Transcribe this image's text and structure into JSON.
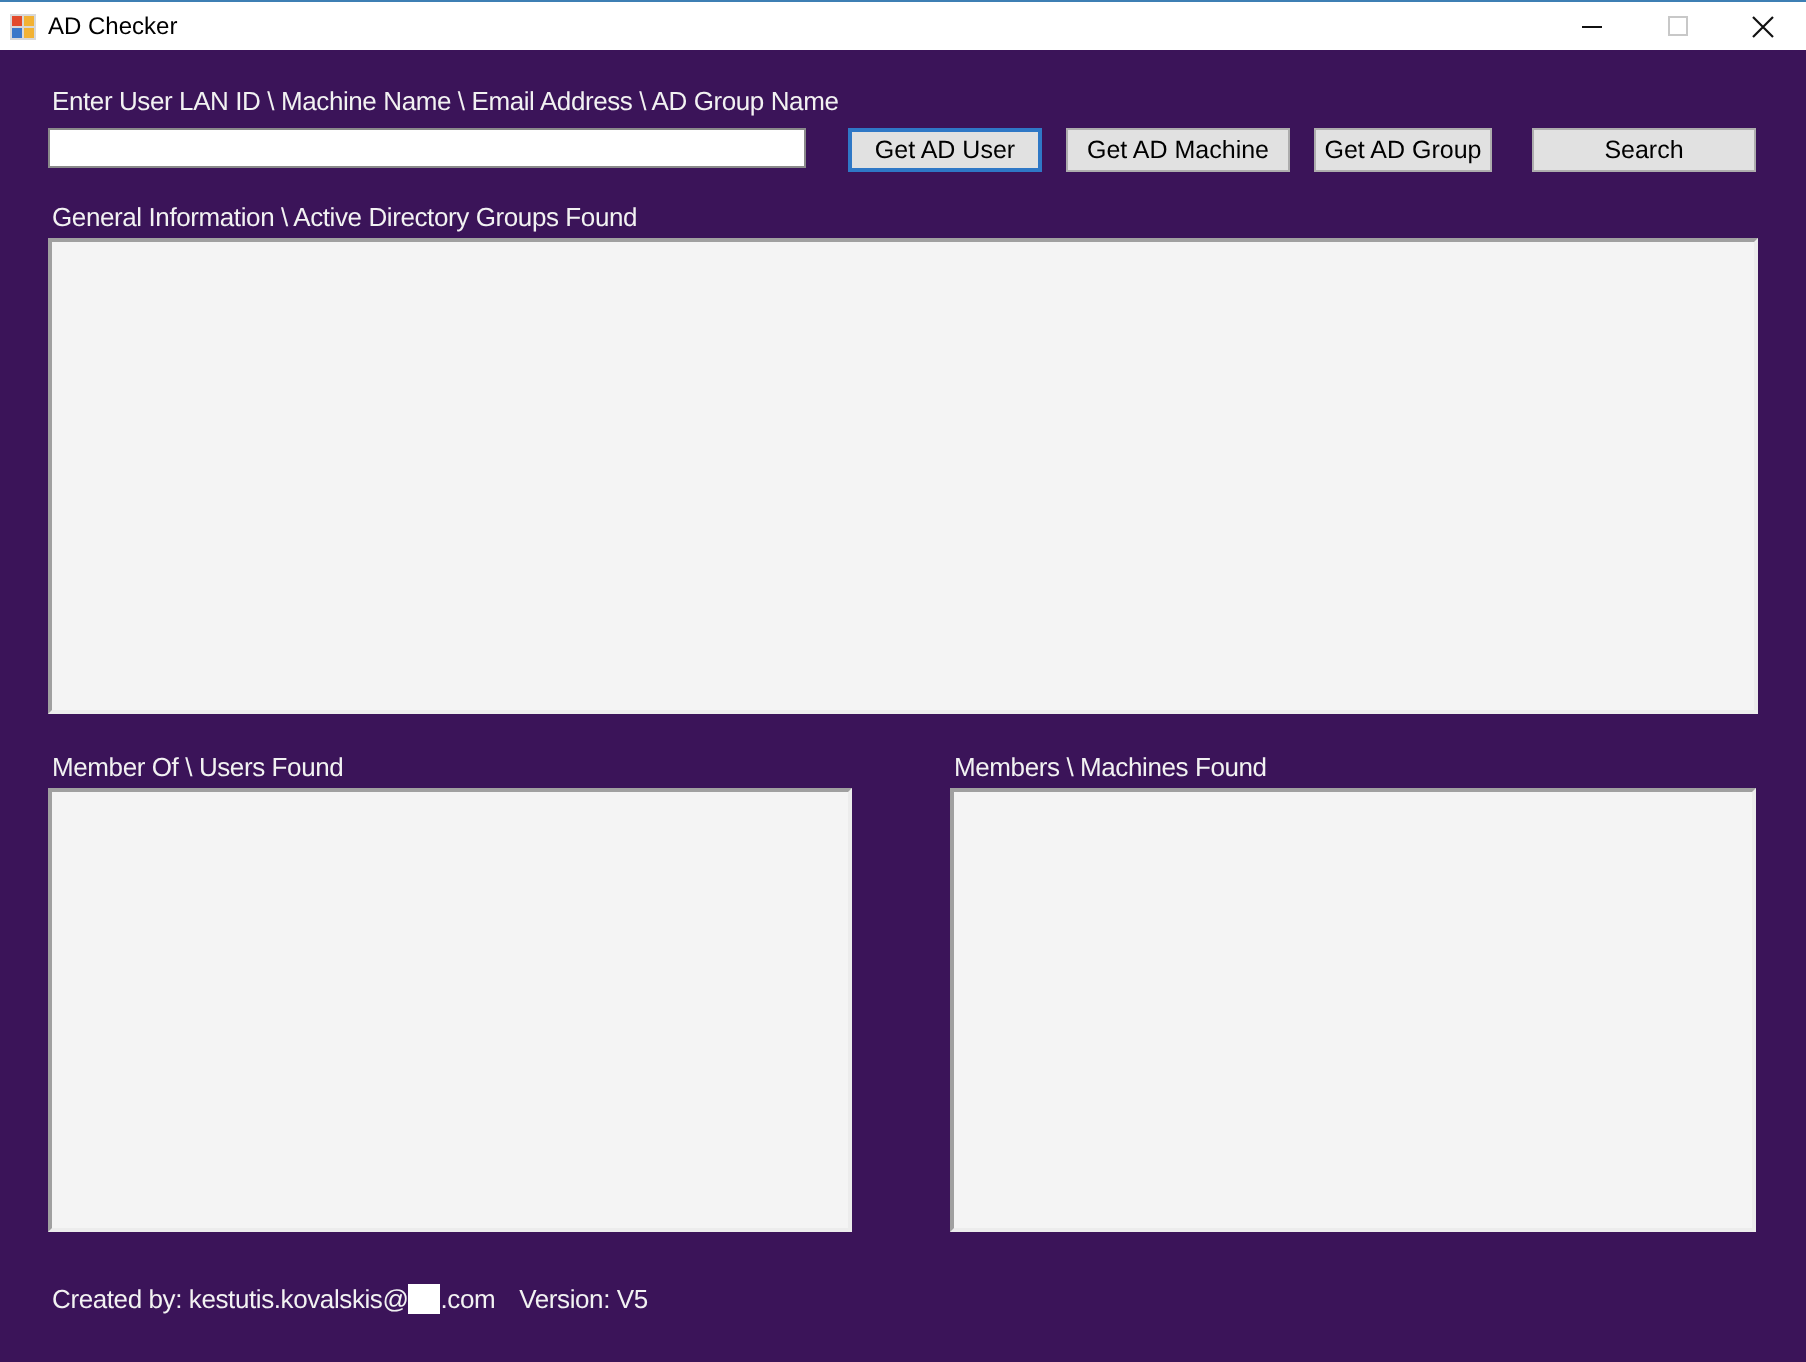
{
  "window": {
    "title": "AD Checker",
    "controls": [
      {
        "kind": "minimize",
        "disabled": false
      },
      {
        "kind": "maximize",
        "disabled": true
      },
      {
        "kind": "close",
        "disabled": false
      }
    ]
  },
  "search": {
    "label": "Enter User LAN ID \\ Machine Name \\ Email Address \\ AD Group Name"
  },
  "buttons": [
    {
      "label": "Get AD User",
      "focused": true
    },
    {
      "label": "Get AD Machine",
      "focused": false
    },
    {
      "label": "Get AD Group",
      "focused": false
    },
    {
      "label": "Search",
      "focused": false
    }
  ],
  "panels": [
    {
      "label": "General Information \\ Active Directory Groups Found"
    },
    {
      "label": "Member Of \\ Users Found"
    },
    {
      "label": "Members \\ Machines Found"
    }
  ],
  "footer": {
    "created_by": "Created by: kestutis.kovalskis@",
    "domain_suffix": ".com",
    "version": "Version: V5"
  }
}
